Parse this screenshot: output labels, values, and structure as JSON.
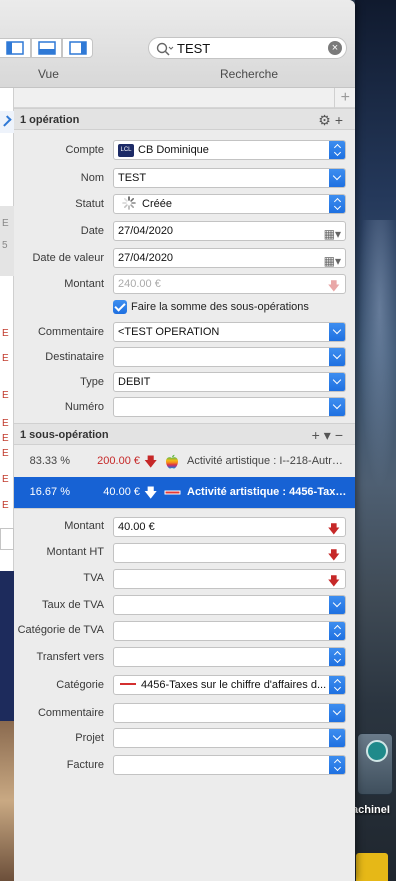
{
  "toolbar": {
    "view_label": "Vue",
    "search_label": "Recherche",
    "search_value": "TEST"
  },
  "operation_section": {
    "title": "1 opération",
    "fields": {
      "compte": {
        "label": "Compte",
        "value": "CB Dominique",
        "logo_text": "LCL"
      },
      "nom": {
        "label": "Nom",
        "value": "TEST"
      },
      "statut": {
        "label": "Statut",
        "value": "Créée"
      },
      "date": {
        "label": "Date",
        "value": "27/04/2020"
      },
      "date_valeur": {
        "label": "Date de valeur",
        "value": "27/04/2020"
      },
      "montant": {
        "label": "Montant",
        "value": "240.00 €"
      },
      "somme_checkbox": {
        "label": "Faire la somme des sous-opérations",
        "checked": true
      },
      "commentaire": {
        "label": "Commentaire",
        "value": "<TEST OPERATION"
      },
      "destinataire": {
        "label": "Destinataire",
        "value": ""
      },
      "type": {
        "label": "Type",
        "value": "DEBIT"
      },
      "numero": {
        "label": "Numéro",
        "value": ""
      }
    }
  },
  "sub_section": {
    "title": "1 sous-opération",
    "actions": "+ - −",
    "rows": [
      {
        "percent": "83.33 %",
        "amount": "200.00 €",
        "description": "Activité artistique : I--218-Autr…",
        "icon": "apple-icon"
      },
      {
        "percent": "16.67 %",
        "amount": "40.00 €",
        "description": "Activité artistique : 4456-Taxe…",
        "icon": "dash-icon",
        "selected": true
      }
    ]
  },
  "sub_fields": {
    "montant": {
      "label": "Montant",
      "value": "40.00 €"
    },
    "montant_ht": {
      "label": "Montant HT",
      "value": ""
    },
    "tva": {
      "label": "TVA",
      "value": ""
    },
    "taux_tva": {
      "label": "Taux de TVA",
      "value": ""
    },
    "categorie_tva": {
      "label": "Catégorie de TVA",
      "value": ""
    },
    "transfert": {
      "label": "Transfert vers",
      "value": ""
    },
    "categorie": {
      "label": "Catégorie",
      "value": "4456-Taxes sur le chiffre d'affaires d..."
    },
    "commentaire": {
      "label": "Commentaire",
      "value": ""
    },
    "projet": {
      "label": "Projet",
      "value": ""
    },
    "facture": {
      "label": "Facture",
      "value": ""
    }
  },
  "desktop": {
    "drive_label": "achineI"
  },
  "colors": {
    "accent": "#1d6fe0",
    "selection": "#1762d4",
    "debit_red": "#c62828"
  }
}
